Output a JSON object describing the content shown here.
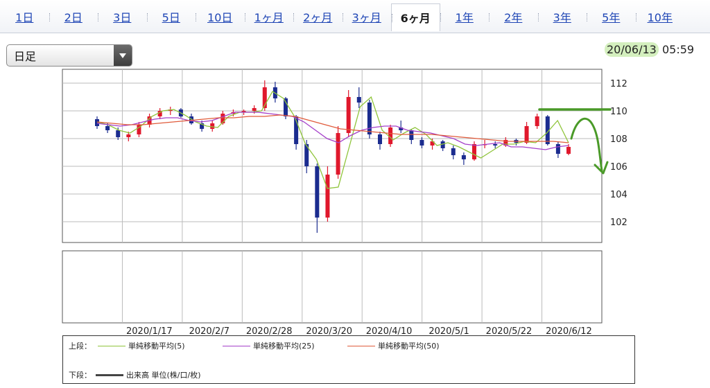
{
  "tabs": [
    {
      "label": "1日"
    },
    {
      "label": "2日"
    },
    {
      "label": "3日"
    },
    {
      "label": "5日"
    },
    {
      "label": "10日"
    },
    {
      "label": "1ヶ月"
    },
    {
      "label": "2ヶ月"
    },
    {
      "label": "3ヶ月"
    },
    {
      "label": "6ヶ月",
      "active": true
    },
    {
      "label": "1年"
    },
    {
      "label": "2年"
    },
    {
      "label": "3年"
    },
    {
      "label": "5年"
    },
    {
      "label": "10年"
    }
  ],
  "period_select": {
    "value": "日足"
  },
  "timestamp": {
    "date": "20/06/13",
    "time": "05:59"
  },
  "legend": {
    "upper_label": "上段：",
    "lower_label": "下段：",
    "lower_item": "出来高 単位(株/口/枚)"
  },
  "colors": {
    "up": "#e0182c",
    "down": "#1b2c8f",
    "ma5": "#8fc43a",
    "ma25": "#a43ec9",
    "ma50": "#e05a3a",
    "annotation": "#4a9a28",
    "volume": "#444444"
  },
  "chart_data": {
    "type": "candlestick",
    "x_ticks": [
      "2020/1/17",
      "2020/2/7",
      "2020/2/28",
      "2020/3/20",
      "2020/4/10",
      "2020/5/1",
      "2020/5/22",
      "2020/6/12"
    ],
    "ylim": [
      100.5,
      113
    ],
    "y_ticks": [
      102,
      104,
      106,
      108,
      110,
      112
    ],
    "grid": true,
    "series": [
      {
        "name": "単純移動平均(5)",
        "type": "line",
        "values": [
          109.2,
          109.0,
          108.6,
          108.4,
          108.9,
          109.6,
          110.0,
          110.1,
          109.7,
          109.2,
          108.9,
          108.8,
          109.6,
          109.9,
          109.9,
          110.0,
          111.4,
          110.9,
          109.6,
          107.6,
          106.5,
          104.4,
          104.5,
          107.4,
          110.3,
          111.0,
          108.6,
          107.9,
          108.4,
          108.8,
          108.3,
          107.5,
          107.7,
          107.4,
          107.0,
          106.6,
          107.1,
          107.6,
          107.6,
          107.8,
          107.7,
          108.4,
          109.3,
          107.7
        ]
      },
      {
        "name": "単純移動平均(25)",
        "type": "line",
        "values": [
          109.1,
          109.0,
          108.9,
          109.0,
          109.2,
          109.4,
          109.5,
          109.5,
          109.3,
          109.2,
          109.3,
          109.6,
          109.9,
          109.9,
          109.9,
          109.8,
          109.7,
          109.6,
          109.2,
          108.6,
          108.0,
          107.7,
          108.2,
          108.6,
          108.8,
          108.9,
          108.9,
          108.6,
          108.5,
          108.4,
          108.2,
          108.0,
          107.6,
          107.5,
          107.6,
          107.7,
          107.4,
          107.4,
          107.3,
          107.2,
          107.4,
          107.5
        ]
      },
      {
        "name": "単純移動平均(50)",
        "type": "line",
        "values": [
          109.2,
          109.1,
          109.0,
          109.0,
          109.1,
          109.2,
          109.3,
          109.4,
          109.5,
          109.5,
          109.6,
          109.6,
          109.7,
          109.6,
          109.3,
          109.0,
          108.7,
          108.6,
          108.5,
          108.4,
          108.3,
          108.3,
          108.3,
          108.2,
          108.1,
          108.0,
          107.9,
          107.8,
          107.8,
          107.8,
          107.8,
          107.7
        ]
      },
      {
        "name": "出来高",
        "type": "bar",
        "values": []
      }
    ],
    "candles": [
      {
        "o": 109.4,
        "h": 109.6,
        "l": 108.7,
        "c": 108.9
      },
      {
        "o": 108.9,
        "h": 109.1,
        "l": 108.4,
        "c": 108.6
      },
      {
        "o": 108.6,
        "h": 108.8,
        "l": 107.9,
        "c": 108.1
      },
      {
        "o": 108.1,
        "h": 108.5,
        "l": 107.8,
        "c": 108.3
      },
      {
        "o": 108.3,
        "h": 109.2,
        "l": 108.1,
        "c": 109.0
      },
      {
        "o": 109.0,
        "h": 109.8,
        "l": 108.8,
        "c": 109.6
      },
      {
        "o": 109.6,
        "h": 110.2,
        "l": 109.4,
        "c": 110.0
      },
      {
        "o": 110.0,
        "h": 110.3,
        "l": 109.7,
        "c": 110.1
      },
      {
        "o": 110.1,
        "h": 110.2,
        "l": 109.5,
        "c": 109.6
      },
      {
        "o": 109.6,
        "h": 109.8,
        "l": 109.0,
        "c": 109.1
      },
      {
        "o": 109.1,
        "h": 109.3,
        "l": 108.5,
        "c": 108.7
      },
      {
        "o": 108.7,
        "h": 109.3,
        "l": 108.5,
        "c": 109.1
      },
      {
        "o": 109.1,
        "h": 110.0,
        "l": 109.0,
        "c": 109.8
      },
      {
        "o": 109.8,
        "h": 110.1,
        "l": 109.6,
        "c": 109.9
      },
      {
        "o": 109.9,
        "h": 110.1,
        "l": 109.7,
        "c": 110.0
      },
      {
        "o": 110.0,
        "h": 110.4,
        "l": 109.8,
        "c": 110.2
      },
      {
        "o": 110.2,
        "h": 112.2,
        "l": 110.0,
        "c": 111.7
      },
      {
        "o": 111.7,
        "h": 112.1,
        "l": 110.6,
        "c": 110.9
      },
      {
        "o": 110.9,
        "h": 111.0,
        "l": 109.4,
        "c": 109.6
      },
      {
        "o": 109.6,
        "h": 109.7,
        "l": 107.2,
        "c": 107.6
      },
      {
        "o": 107.6,
        "h": 107.9,
        "l": 105.5,
        "c": 106.0
      },
      {
        "o": 106.0,
        "h": 106.2,
        "l": 101.2,
        "c": 102.3
      },
      {
        "o": 102.3,
        "h": 106.0,
        "l": 102.0,
        "c": 105.4
      },
      {
        "o": 105.4,
        "h": 108.9,
        "l": 105.1,
        "c": 108.4
      },
      {
        "o": 108.4,
        "h": 111.5,
        "l": 108.1,
        "c": 111.0
      },
      {
        "o": 111.0,
        "h": 111.7,
        "l": 110.2,
        "c": 110.6
      },
      {
        "o": 110.6,
        "h": 110.8,
        "l": 108.0,
        "c": 108.3
      },
      {
        "o": 108.3,
        "h": 108.5,
        "l": 107.2,
        "c": 107.6
      },
      {
        "o": 107.6,
        "h": 109.0,
        "l": 107.4,
        "c": 108.8
      },
      {
        "o": 108.8,
        "h": 109.3,
        "l": 108.4,
        "c": 108.6
      },
      {
        "o": 108.6,
        "h": 108.7,
        "l": 107.6,
        "c": 107.9
      },
      {
        "o": 107.9,
        "h": 108.1,
        "l": 107.3,
        "c": 107.5
      },
      {
        "o": 107.5,
        "h": 108.0,
        "l": 107.2,
        "c": 107.8
      },
      {
        "o": 107.8,
        "h": 107.9,
        "l": 107.1,
        "c": 107.3
      },
      {
        "o": 107.3,
        "h": 107.5,
        "l": 106.5,
        "c": 106.8
      },
      {
        "o": 106.8,
        "h": 107.0,
        "l": 106.1,
        "c": 106.5
      },
      {
        "o": 106.5,
        "h": 107.8,
        "l": 106.4,
        "c": 107.6
      },
      {
        "o": 107.6,
        "h": 107.9,
        "l": 107.3,
        "c": 107.6
      },
      {
        "o": 107.6,
        "h": 107.8,
        "l": 107.3,
        "c": 107.5
      },
      {
        "o": 107.5,
        "h": 108.1,
        "l": 107.4,
        "c": 107.9
      },
      {
        "o": 107.9,
        "h": 108.0,
        "l": 107.5,
        "c": 107.7
      },
      {
        "o": 107.7,
        "h": 109.2,
        "l": 107.6,
        "c": 108.9
      },
      {
        "o": 108.9,
        "h": 109.8,
        "l": 108.7,
        "c": 109.6
      },
      {
        "o": 109.6,
        "h": 109.7,
        "l": 107.5,
        "c": 107.6
      },
      {
        "o": 107.6,
        "h": 107.8,
        "l": 106.6,
        "c": 106.9
      },
      {
        "o": 106.9,
        "h": 107.6,
        "l": 106.8,
        "c": 107.4
      }
    ]
  }
}
